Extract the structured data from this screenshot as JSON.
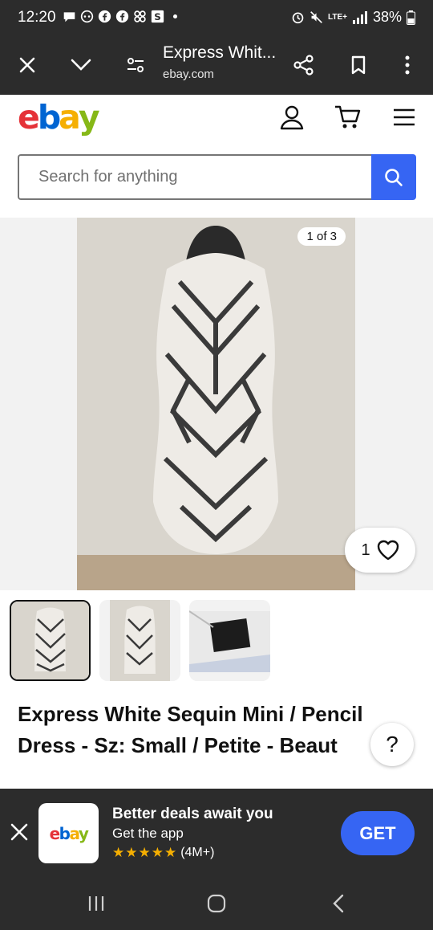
{
  "status_bar": {
    "time": "12:20",
    "battery": "38%",
    "network": "LTE+"
  },
  "browser": {
    "page_title": "Express Whit...",
    "host": "ebay.com"
  },
  "header": {
    "logo_letters": [
      "e",
      "b",
      "a",
      "y"
    ],
    "logo_colors": [
      "#e53238",
      "#0064d2",
      "#f5af02",
      "#86b817"
    ]
  },
  "search": {
    "placeholder": "Search for anything"
  },
  "gallery": {
    "counter": "1 of 3",
    "watch_count": "1"
  },
  "listing": {
    "title_line1": "Express White Sequin Mini / Pencil",
    "title_line2": "Dress - Sz: Small / Petite - Beaut"
  },
  "help": {
    "label": "?"
  },
  "app_banner": {
    "logo": "ebay",
    "heading": "Better deals await you",
    "subheading": "Get the app",
    "stars": "★★★★★",
    "rating_count": "(4M+)",
    "get_label": "GET"
  },
  "colors": {
    "accent_blue": "#3665f3",
    "dark_bar": "#2c2c2c"
  }
}
